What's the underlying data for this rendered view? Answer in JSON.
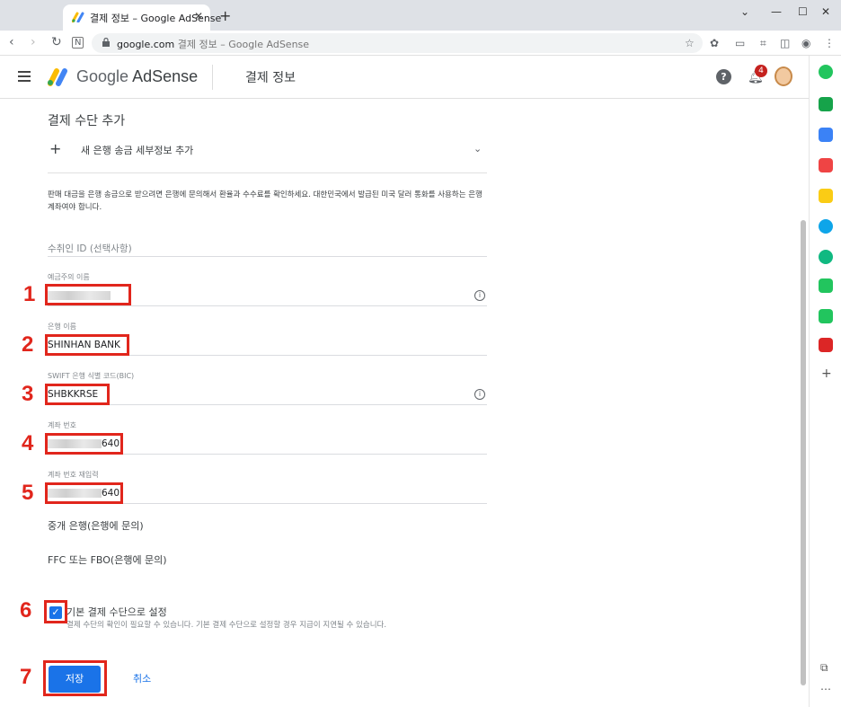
{
  "browser": {
    "tab_title": "결제 정보 – Google AdSense",
    "tab_close": "✕",
    "new_tab": "+",
    "url_host": "google.com",
    "url_title": "결제 정보 – Google AdSense"
  },
  "header": {
    "brand_google": "Google",
    "brand_product": "AdSense",
    "page_title": "결제 정보",
    "help": "?",
    "notification_count": "4"
  },
  "form": {
    "section_title": "결제 수단 추가",
    "expander_label": "새 은행 송금 세부정보 추가",
    "description": "판매 대금을 은행 송금으로 받으려면 은행에 문의해서 환율과 수수료를 확인하세요. 대한민국에서 발급된 미국 달러 통화를 사용하는 은행 계좌여야 합니다.",
    "payee_id_placeholder": "수취인 ID (선택사항)",
    "account_holder_label": "예금주의 이름",
    "bank_name_label": "은행 이름",
    "bank_name_value": "SHINHAN BANK",
    "swift_label": "SWIFT 은행 식별 코드(BIC)",
    "swift_value": "SHBKKRSE",
    "account_number_label": "계좌 번호",
    "account_number_suffix": "640",
    "account_number_confirm_label": "계좌 번호 재입력",
    "account_number_confirm_suffix": "640",
    "intermediary_bank": "중개 은행(은행에 문의)",
    "ffc_label": "FFC 또는 FBO(은행에 문의)",
    "default_checkbox_label": "기본 결제 수단으로 설정",
    "default_checkbox_note": "결제 수단의 확인이 필요할 수 있습니다. 기본 결제 수단으로 설정할 경우 지급이 지연될 수 있습니다.",
    "save_label": "저장",
    "cancel_label": "취소"
  },
  "annotations": [
    "1",
    "2",
    "3",
    "4",
    "5",
    "6",
    "7"
  ],
  "colors": {
    "accent": "#1a73e8",
    "annotation_red": "#e1261c"
  }
}
